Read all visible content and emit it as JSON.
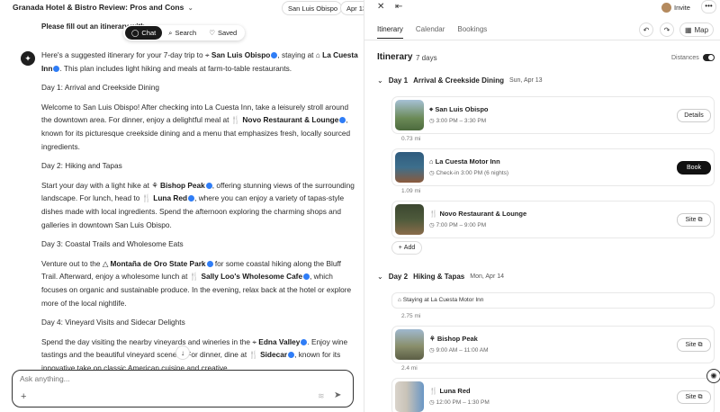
{
  "left": {
    "doc_title": "Granada Hotel & Bistro Review: Pros and Cons",
    "pills": [
      "San Luis Obispo",
      "Apr 13"
    ],
    "intro": "Please fill out an itinerary with",
    "tabs": [
      "Chat",
      "Search",
      "Saved"
    ],
    "message": {
      "p1": [
        "Here's a suggested itinerary for your 7-day trip to ",
        "San Luis Obispo",
        ", staying at ",
        "La Cuesta Inn",
        ". This plan includes light hiking and meals at farm-to-table restaurants."
      ],
      "d1h": "Day 1: Arrival and Creekside Dining",
      "d1": [
        "Welcome to San Luis Obispo! After checking into La Cuesta Inn, take a leisurely stroll around the downtown area. For dinner, enjoy a delightful meal at ",
        "Novo Restaurant & Lounge",
        ", known for its picturesque creekside dining and a menu that emphasizes fresh, locally sourced ingredients."
      ],
      "d2h": "Day 2: Hiking and Tapas",
      "d2": [
        "Start your day with a light hike at ",
        "Bishop Peak",
        ", offering stunning views of the surrounding landscape. For lunch, head to ",
        "Luna Red",
        ", where you can enjoy a variety of tapas-style dishes made with local ingredients. Spend the afternoon exploring the charming shops and galleries in downtown San Luis Obispo."
      ],
      "d3h": "Day 3: Coastal Trails and Wholesome Eats",
      "d3": [
        "Venture out to the ",
        "Montaña de Oro State Park",
        " for some coastal hiking along the Bluff Trail. Afterward, enjoy a wholesome lunch at ",
        "Sally Loo's Wholesome Cafe",
        ", which focuses on organic and sustainable produce. In the evening, relax back at the hotel or explore more of the local nightlife."
      ],
      "d4h": "Day 4: Vineyard Visits and Sidecar Delights",
      "d4": [
        "Spend the day visiting the nearby vineyards and wineries in the ",
        "Edna Valley",
        ". Enjoy wine tastings and the beautiful vineyard scenery. For dinner, dine at ",
        "Sidecar",
        ", known for its innovative take on classic American cuisine and creative"
      ]
    },
    "composer_placeholder": "Ask anything..."
  },
  "right": {
    "invite": "Invite",
    "tabs": [
      "Itinerary",
      "Calendar",
      "Bookings"
    ],
    "map_label": "Map",
    "title": "Itinerary",
    "days_count": "7 days",
    "distances_label": "Distances",
    "day1": {
      "label": "Day 1",
      "title": "Arrival & Creekside Dining",
      "date": "Sun, Apr 13"
    },
    "day2": {
      "label": "Day 2",
      "title": "Hiking & Tapas",
      "date": "Mon, Apr 14"
    },
    "items": [
      {
        "name": "San Luis Obispo",
        "meta": "3:00 PM – 3:30 PM",
        "btn": "Details",
        "dist": "0.73 mi",
        "color": "#6b8a57"
      },
      {
        "name": "La Cuesta Motor Inn",
        "meta": "Check-in 3:00 PM (6 nights)",
        "btn": "Book",
        "dist": "1.09 mi",
        "color": "#3d6f8c"
      },
      {
        "name": "Novo Restaurant & Lounge",
        "meta": "7:00 PM – 9:00 PM",
        "btn": "Site",
        "dist": "",
        "color": "#4e5a3b"
      },
      {
        "name": "Bishop Peak",
        "meta": "9:00 AM – 11:00 AM",
        "btn": "Site",
        "dist": "2.4 mi",
        "color": "#8a8f6c"
      },
      {
        "name": "Luna Red",
        "meta": "12:00 PM – 1:30 PM",
        "btn": "Site",
        "dist": "",
        "color": "#c9c3b8"
      }
    ],
    "add_label": "Add",
    "stay_label": "Staying at La Cuesta Motor Inn",
    "stay_dist": "2.75 mi"
  }
}
